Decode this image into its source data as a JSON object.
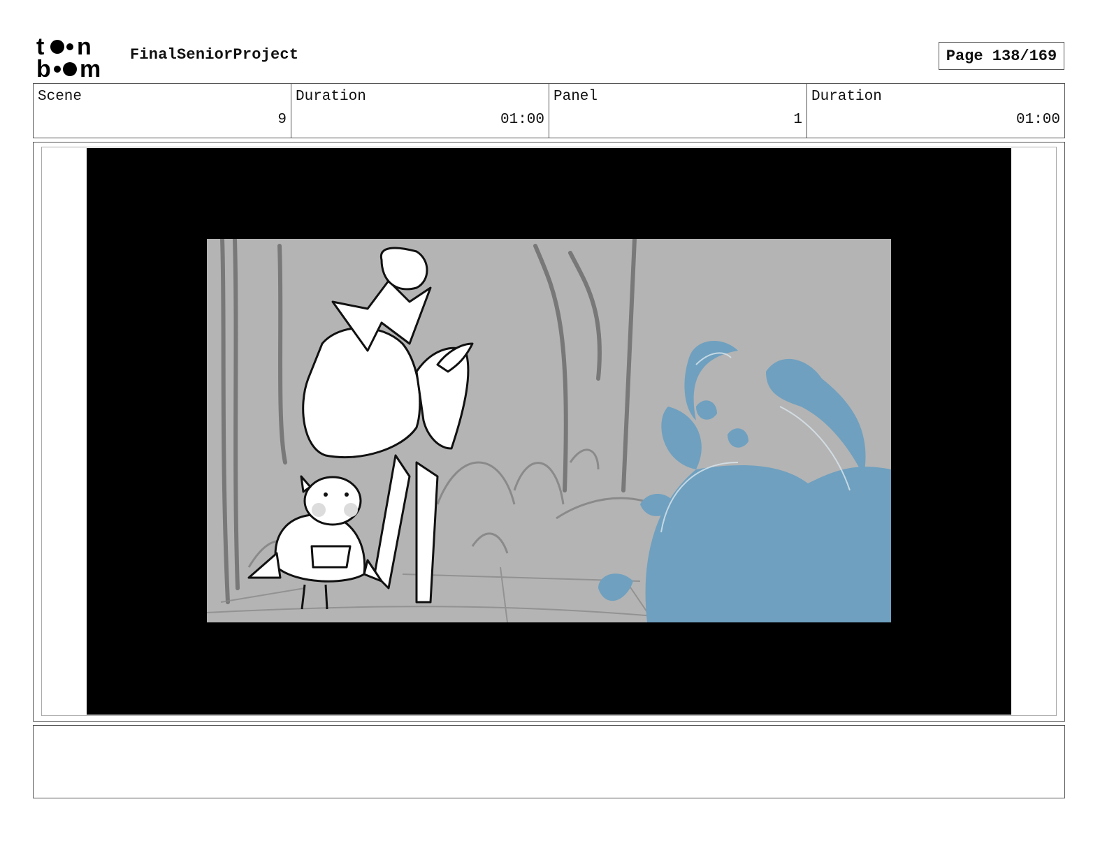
{
  "header": {
    "logo_name": "toonboom-logo",
    "project_title": "FinalSeniorProject",
    "page_label": "Page 138/169"
  },
  "info": {
    "scene_label": "Scene",
    "scene_value": "9",
    "scene_duration_label": "Duration",
    "scene_duration_value": "01:00",
    "panel_label": "Panel",
    "panel_value": "1",
    "panel_duration_label": "Duration",
    "panel_duration_value": "01:00"
  },
  "notes": {
    "text": ""
  },
  "colors": {
    "frame_border": "#555555",
    "letterbox": "#000000",
    "sketch_background": "#b4b4b4",
    "magic_blue": "#6fa0bf"
  }
}
